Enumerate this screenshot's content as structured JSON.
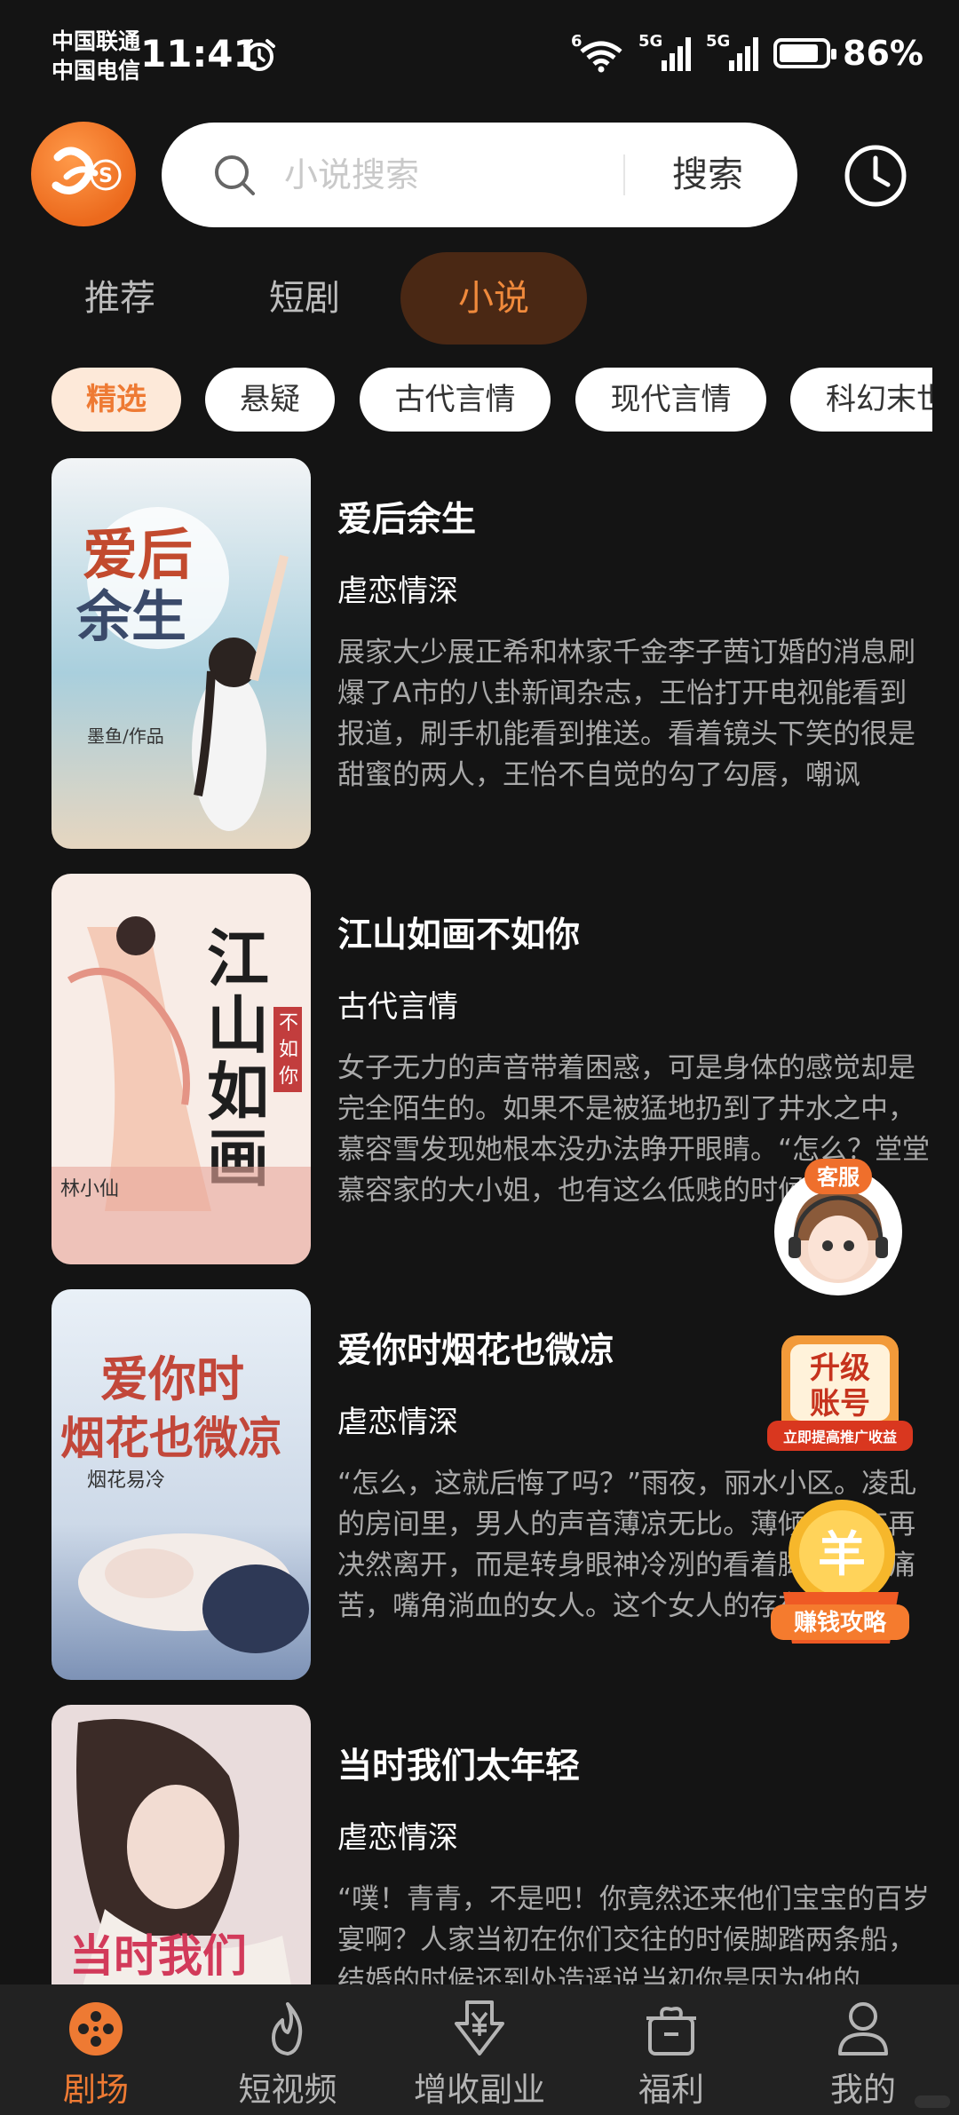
{
  "status_bar": {
    "carrier_1": "中国联通",
    "carrier_2": "中国电信",
    "time": "11:41",
    "wifi_tag": "6",
    "signal_1_tag": "5G",
    "signal_2_tag": "5G",
    "battery_level": 0.86,
    "battery_text": "86%"
  },
  "header": {
    "logo_letter": "S",
    "search_placeholder": "小说搜索",
    "search_button": "搜索",
    "history_icon": "clock-icon"
  },
  "tabs": [
    {
      "label": "推荐",
      "active": false
    },
    {
      "label": "短剧",
      "active": false
    },
    {
      "label": "小说",
      "active": true
    }
  ],
  "chips": [
    {
      "label": "精选",
      "active": true
    },
    {
      "label": "悬疑",
      "active": false
    },
    {
      "label": "古代言情",
      "active": false
    },
    {
      "label": "现代言情",
      "active": false
    },
    {
      "label": "科幻末世",
      "active": false
    }
  ],
  "books": [
    {
      "title": "爱后余生",
      "genre": "虐恋情深",
      "description": "展家大少展正希和林家千金李子茜订婚的消息刷爆了A市的八卦新闻杂志，王怡打开电视能看到报道，刷手机能看到推送。看着镜头下笑的很是甜蜜的两人，王怡不自觉的勾了勾唇，嘲讽",
      "cover_title": "爱后余生",
      "cover_author": "墨鱼/作品",
      "cover_colors": [
        "#e9eef2",
        "#9fc7d8",
        "#e3d3bd"
      ]
    },
    {
      "title": "江山如画不如你",
      "genre": "古代言情",
      "description": "女子无力的声音带着困惑，可是身体的感觉却是完全陌生的。如果不是被猛地扔到了井水之中，慕容雪发现她根本没办法睁开眼睛。“怎么？堂堂慕容家的大小姐，也有这么低贱的时候",
      "cover_title": "江山如画",
      "cover_subtitle": "不如你",
      "cover_author": "林小仙",
      "cover_colors": [
        "#f8ece6",
        "#f1c3ad",
        "#e3877a"
      ]
    },
    {
      "title": "爱你时烟花也微凉",
      "genre": "虐恋情深",
      "description": "“怎么，这就后悔了吗？”雨夜，丽水小区。凌乱的房间里，男人的声音薄凉无比。薄倾城没有再决然离开，而是转身眼神冷冽的看着脚下满脸痛苦，嘴角淌血的女人。这个女人的存在。",
      "cover_title": "爱你时烟花也微凉",
      "cover_author": "烟花易冷",
      "cover_colors": [
        "#dfe8f1",
        "#c8d4e4",
        "#4a5e86"
      ]
    },
    {
      "title": "当时我们太年轻",
      "genre": "虐恋情深",
      "description": "“噗！青青，不是吧！你竟然还来他们宝宝的百岁宴啊？人家当初在你们交往的时候脚踏两条船，结婚的时候还到处造谣说当初你是因为他的",
      "cover_title": "当时我们",
      "cover_colors": [
        "#e6d8d8",
        "#b59d99",
        "#d23a5a"
      ]
    }
  ],
  "floating": {
    "service_label": "客服",
    "upgrade_line1": "升级",
    "upgrade_line2": "账号",
    "upgrade_sub": "立即提高推广收益",
    "earn_symbol": "羊",
    "earn_label": "赚钱攻略"
  },
  "bottom_nav": [
    {
      "label": "剧场",
      "icon": "film-reel-icon",
      "active": true
    },
    {
      "label": "短视频",
      "icon": "flame-icon",
      "active": false
    },
    {
      "label": "增收副业",
      "icon": "yen-download-icon",
      "active": false
    },
    {
      "label": "福利",
      "icon": "gift-box-icon",
      "active": false
    },
    {
      "label": "我的",
      "icon": "person-icon",
      "active": false
    }
  ]
}
